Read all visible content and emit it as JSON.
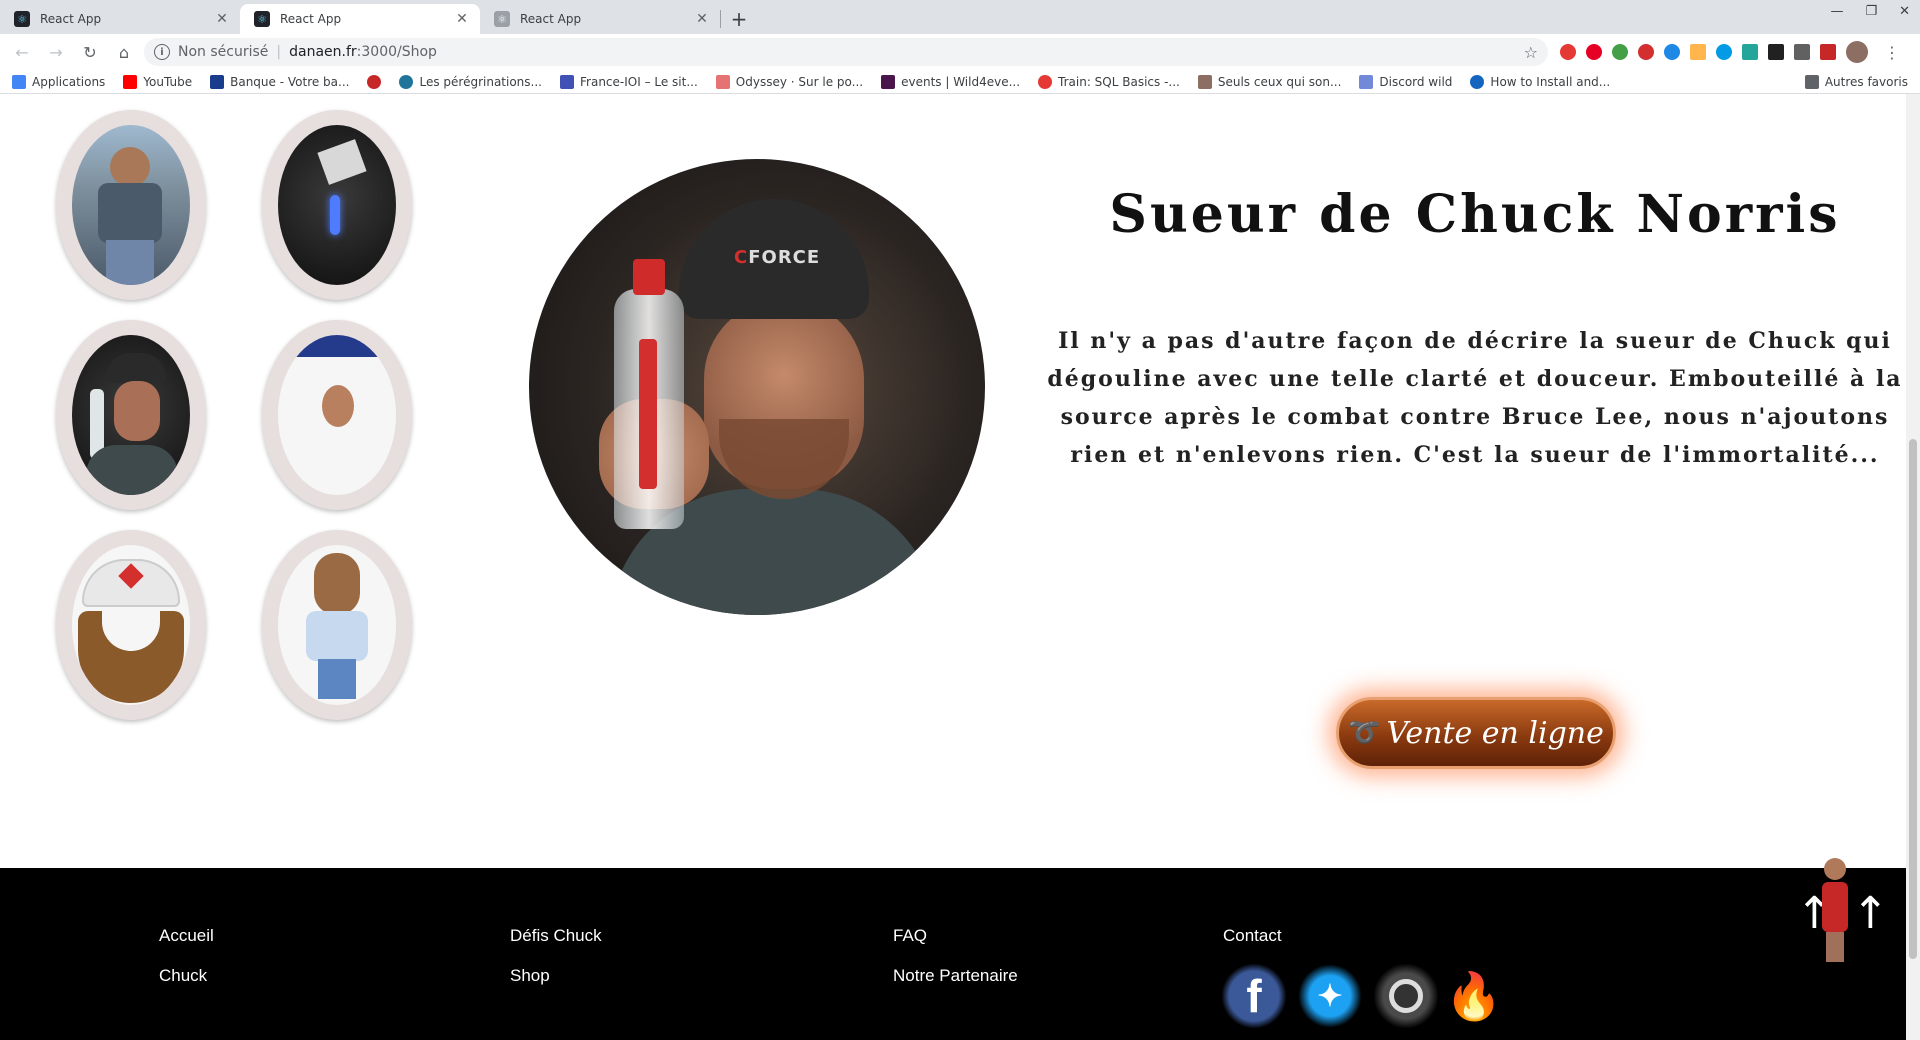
{
  "browser": {
    "tabs": [
      {
        "title": "React App",
        "active": false
      },
      {
        "title": "React App",
        "active": true
      },
      {
        "title": "React App",
        "active": false
      }
    ],
    "address": {
      "security_label": "Non sécurisé",
      "host": "danaen.fr",
      "path": ":3000/Shop"
    },
    "bookmarks": [
      {
        "label": "Applications",
        "color": "#4285f4"
      },
      {
        "label": "YouTube",
        "color": "#ff0000"
      },
      {
        "label": "Banque - Votre ba...",
        "color": "#1a3c8c"
      },
      {
        "label": "",
        "color": "#c62828"
      },
      {
        "label": "Les pérégrinations...",
        "color": "#21759b"
      },
      {
        "label": "France-IOI – Le sit...",
        "color": "#3f51b5"
      },
      {
        "label": "Odyssey · Sur le po...",
        "color": "#e57373"
      },
      {
        "label": "events | Wild4eve...",
        "color": "#4a154b"
      },
      {
        "label": "Train: SQL Basics -...",
        "color": "#e53935"
      },
      {
        "label": "Seuls ceux qui son...",
        "color": "#8d6e63"
      },
      {
        "label": "Discord wild",
        "color": "#7289da"
      },
      {
        "label": "How to Install and...",
        "color": "#1565c0"
      }
    ],
    "other_bookmarks": "Autres favoris"
  },
  "shop": {
    "thumbnails": [
      {
        "name": "chuck-photo-thumb",
        "style": "photo"
      },
      {
        "name": "sweat-device-thumb",
        "style": "dark"
      },
      {
        "name": "chuck-bottle-thumb",
        "style": "dark"
      },
      {
        "name": "chuck-underwear-thumb",
        "style": "light"
      },
      {
        "name": "beard-cap-thumb",
        "style": "light"
      },
      {
        "name": "chuck-figurine-thumb",
        "style": "light"
      }
    ],
    "hero_cap_text": "FORCE",
    "title": "Sueur de Chuck Norris",
    "description": "Il n'y a pas d'autre façon de décrire la sueur de Chuck qui dégouline avec une telle clarté et douceur. Embouteillé à la source après le combat contre Bruce Lee, nous n'ajoutons rien et n'enlevons rien. C'est la sueur de l'immortalité...",
    "cta_label": "Vente en ligne"
  },
  "footer": {
    "col1": [
      "Accueil",
      "Chuck"
    ],
    "col2": [
      "Défis Chuck",
      "Shop"
    ],
    "col3": [
      "FAQ",
      "Notre Partenaire"
    ],
    "col4_title": "Contact",
    "socials": [
      "facebook-icon",
      "twitter-icon",
      "instagram-icon",
      "tinder-icon"
    ]
  }
}
